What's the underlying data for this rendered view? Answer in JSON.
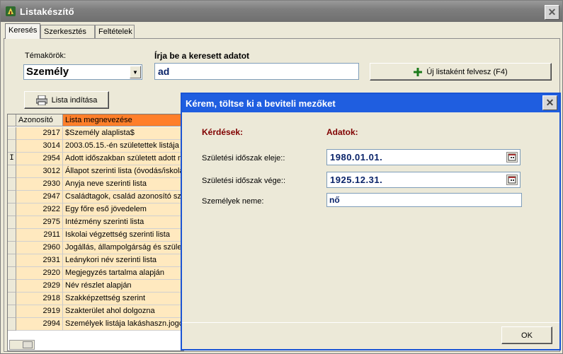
{
  "window": {
    "title": "Listakészítő",
    "close_glyph": "✕"
  },
  "tabs": [
    {
      "label": "Keresés",
      "active": true
    },
    {
      "label": "Szerkesztés",
      "active": false
    },
    {
      "label": "Feltételek",
      "active": false
    }
  ],
  "search": {
    "topics_label": "Témakörök:",
    "topic_value": "Személy",
    "query_label": "Írja be a keresett adatot",
    "query_value": "ad",
    "new_list_button": "Új listaként felvesz  (F4)",
    "run_list_button": "Lista indítása"
  },
  "grid": {
    "columns": [
      "Azonosító",
      "Lista megnevezése"
    ],
    "current_row_marker": "I",
    "rows": [
      {
        "id": "2917",
        "name": " $Személy alaplista$"
      },
      {
        "id": "3014",
        "name": "2003.05.15.-én születettek listája"
      },
      {
        "id": "2954",
        "name": "Adott időszakban született adott ne"
      },
      {
        "id": "3012",
        "name": "Állapot szerinti lista (óvodás/iskolás"
      },
      {
        "id": "2930",
        "name": "Anyja neve szerinti lista"
      },
      {
        "id": "2947",
        "name": "Családtagok, család azonosító szár"
      },
      {
        "id": "2922",
        "name": "Egy főre eső jövedelem"
      },
      {
        "id": "2975",
        "name": "Intézmény szerinti lista"
      },
      {
        "id": "2911",
        "name": "Iskolai végzettség szerinti lista"
      },
      {
        "id": "2960",
        "name": "Jogállás, állampolgárság és születé"
      },
      {
        "id": "2931",
        "name": "Leánykori név szerinti lista"
      },
      {
        "id": "2920",
        "name": "Megjegyzés tartalma alapján"
      },
      {
        "id": "2929",
        "name": "Név részlet alapján"
      },
      {
        "id": "2918",
        "name": "Szakképzettség szerint"
      },
      {
        "id": "2919",
        "name": "Szakterület ahol dolgozna"
      },
      {
        "id": "2994",
        "name": "Személyek listája lakáshaszn.jogcír"
      }
    ]
  },
  "dialog": {
    "title": "Kérem, töltse ki a beviteli mezőket",
    "close_glyph": "✕",
    "questions_header": "Kérdések:",
    "data_header": "Adatok:",
    "fields": [
      {
        "label": "Születési időszak eleje::",
        "value": "1980.01.01."
      },
      {
        "label": "Születési időszak vége::",
        "value": "1925.12.31."
      },
      {
        "label": "Személyek neme:",
        "value": "nő"
      }
    ],
    "ok_button": "OK"
  },
  "colors": {
    "dialog_title_bg": "#1f5ee0",
    "grid_row_bg": "#ffe9bf",
    "grid_sorted_header_bg": "#ff7f2a",
    "dialog_header_text": "#800000"
  }
}
